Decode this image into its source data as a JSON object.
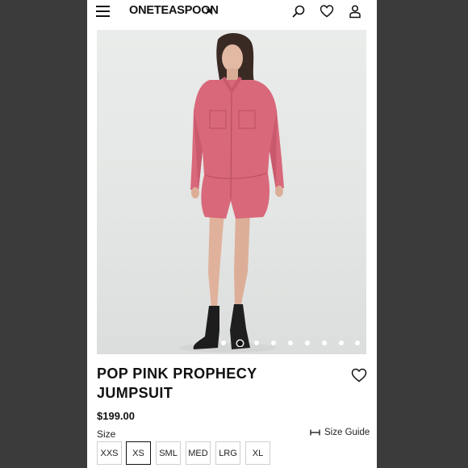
{
  "header": {
    "brand": "ONETEASPOON",
    "icons": [
      "menu-icon",
      "search-icon",
      "heart-icon",
      "account-icon"
    ]
  },
  "gallery": {
    "image_count": 9,
    "active_index": 1
  },
  "product": {
    "title": "POP PINK PROPHECY JUMPSUIT",
    "price": "$199.00",
    "size_label": "Size",
    "size_guide_label": "Size Guide",
    "sizes": [
      "XXS",
      "XS",
      "SML",
      "MED",
      "LRG",
      "XL"
    ],
    "selected_size": "XS"
  },
  "colors": {
    "garment": "#d9687a",
    "background": "#3b3b3b",
    "text": "#111111"
  }
}
